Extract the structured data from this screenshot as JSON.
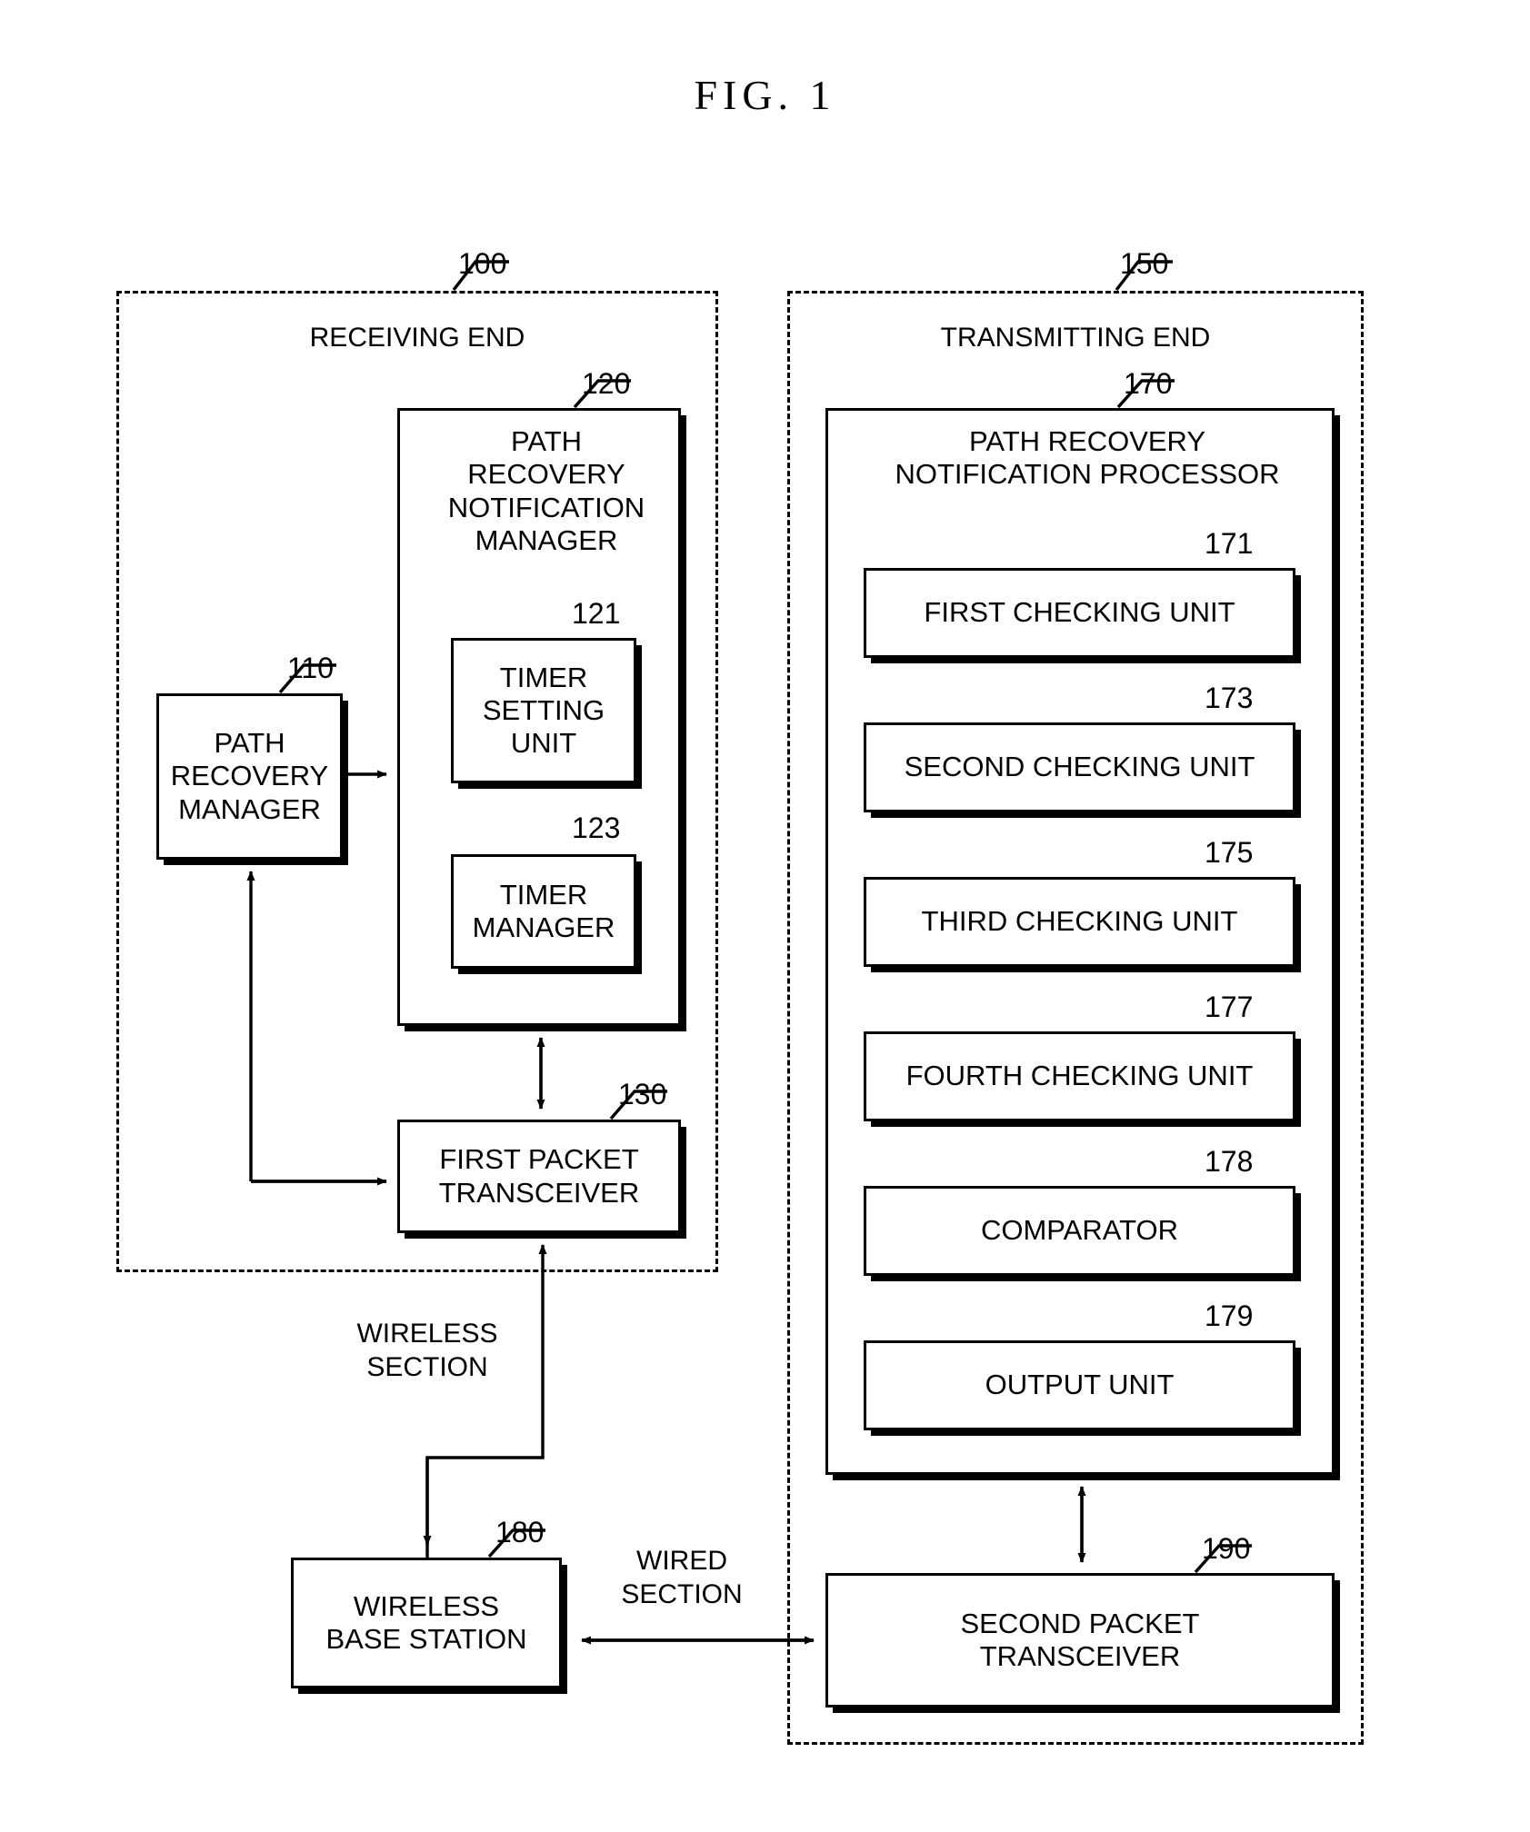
{
  "figure": {
    "title": "FIG.  1"
  },
  "regions": [
    {
      "id": "receiving-end",
      "title": "RECEIVING END",
      "ref": "100"
    },
    {
      "id": "transmitting-end",
      "title": "TRANSMITTING END",
      "ref": "150"
    }
  ],
  "nodes": {
    "path_recovery_manager": {
      "ref": "110",
      "label": "PATH\nRECOVERY\nMANAGER"
    },
    "path_recovery_notification_manager": {
      "ref": "120",
      "label": "PATH\nRECOVERY\nNOTIFICATION\nMANAGER"
    },
    "timer_setting_unit": {
      "ref": "121",
      "label": "TIMER\nSETTING\nUNIT"
    },
    "timer_manager": {
      "ref": "123",
      "label": "TIMER\nMANAGER"
    },
    "first_packet_transceiver": {
      "ref": "130",
      "label": "FIRST PACKET\nTRANSCEIVER"
    },
    "path_recovery_notification_processor": {
      "ref": "170",
      "label": "PATH RECOVERY\nNOTIFICATION PROCESSOR"
    },
    "first_checking_unit": {
      "ref": "171",
      "label": "FIRST CHECKING UNIT"
    },
    "second_checking_unit": {
      "ref": "173",
      "label": "SECOND CHECKING UNIT"
    },
    "third_checking_unit": {
      "ref": "175",
      "label": "THIRD CHECKING UNIT"
    },
    "fourth_checking_unit": {
      "ref": "177",
      "label": "FOURTH CHECKING UNIT"
    },
    "comparator": {
      "ref": "178",
      "label": "COMPARATOR"
    },
    "output_unit": {
      "ref": "179",
      "label": "OUTPUT UNIT"
    },
    "wireless_base_station": {
      "ref": "180",
      "label": "WIRELESS\nBASE STATION"
    },
    "second_packet_transceiver": {
      "ref": "190",
      "label": "SECOND PACKET\nTRANSCEIVER"
    }
  },
  "edge_labels": {
    "wireless_section": "WIRELESS\nSECTION",
    "wired_section": "WIRED\nSECTION"
  },
  "colors": {
    "stroke": "#000000",
    "background": "#ffffff"
  }
}
